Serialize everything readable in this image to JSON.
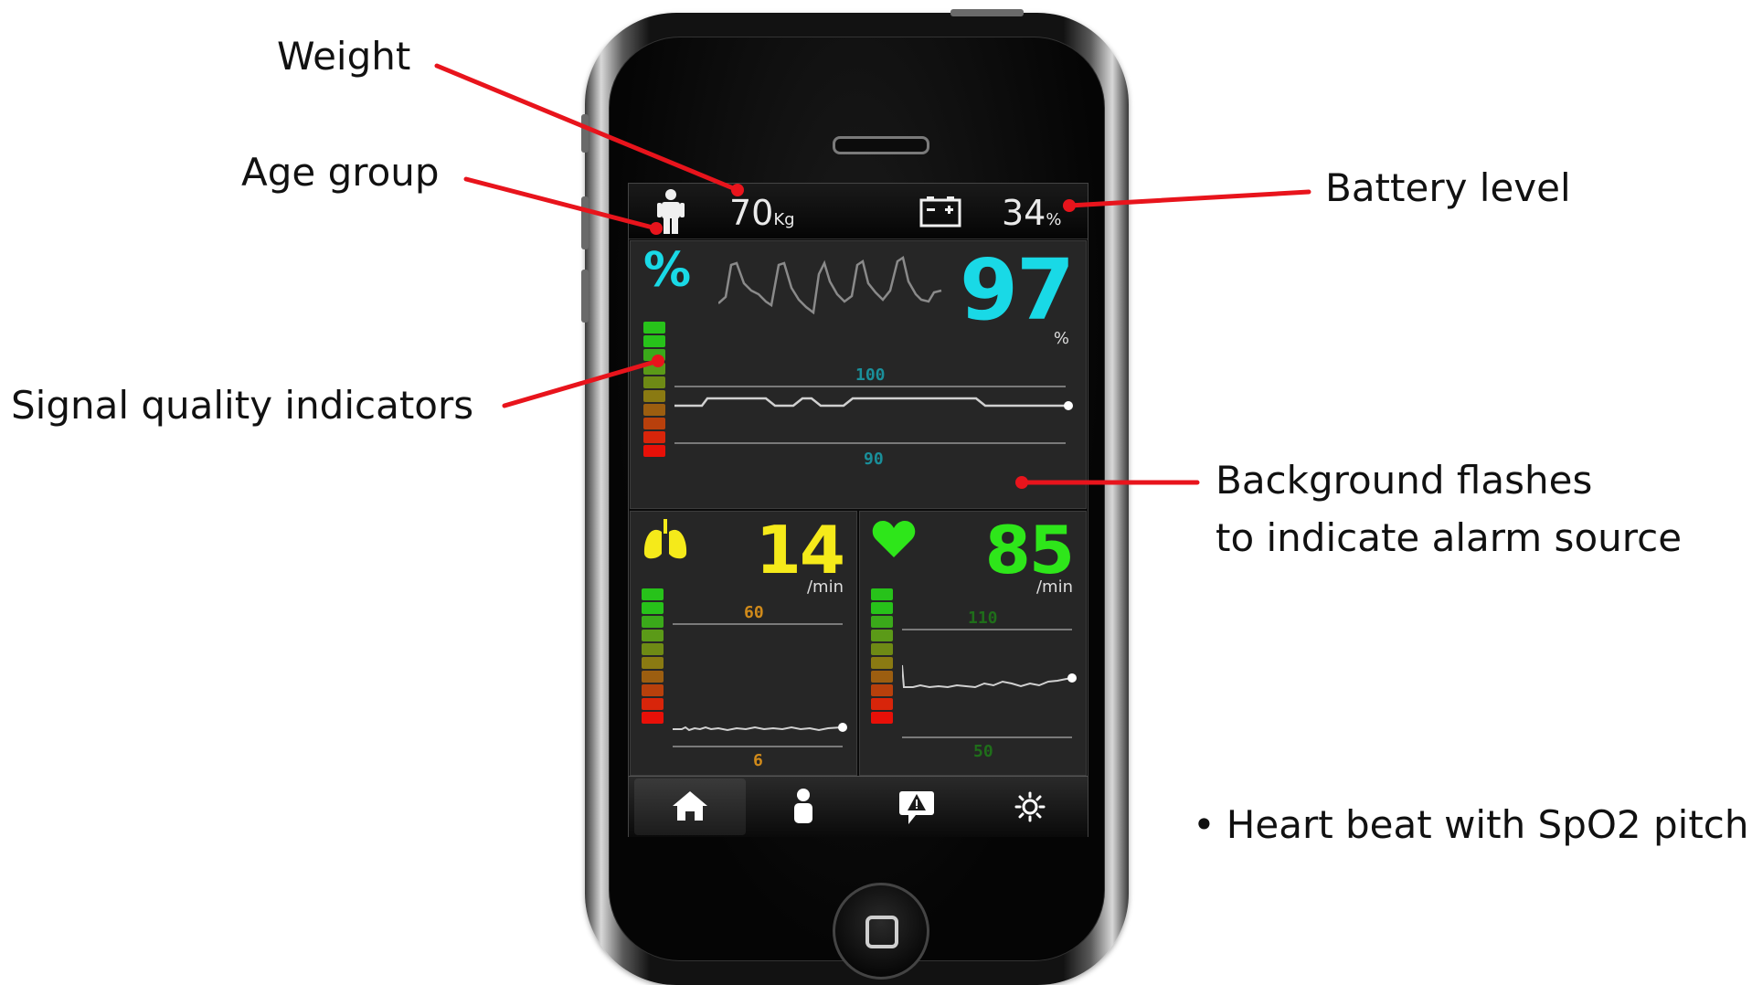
{
  "annotations": {
    "weight": "Weight",
    "age_group": "Age group",
    "battery_level": "Battery level",
    "signal_quality": "Signal quality indicators",
    "background_flash_line1": "Background flashes",
    "background_flash_line2": "to indicate alarm source",
    "heart_beat_note": "Heart beat with SpO2 pitch"
  },
  "status_bar": {
    "weight_value": "70",
    "weight_unit": "Kg",
    "battery_value": "34",
    "battery_unit": "%"
  },
  "spo2": {
    "symbol": "%",
    "value": "97",
    "unit": "%",
    "upper_limit": "100",
    "lower_limit": "90",
    "color": "#19d9e6"
  },
  "respiration": {
    "value": "14",
    "unit": "/min",
    "upper_limit": "60",
    "lower_limit": "6",
    "color": "#f5ea1a",
    "limit_color": "#d08a1a"
  },
  "heart_rate": {
    "value": "85",
    "unit": "/min",
    "upper_limit": "110",
    "lower_limit": "50",
    "color": "#2ee61a",
    "limit_color": "#1f6e1a"
  },
  "signal_quality_colors": [
    "#27c21a",
    "#27c21a",
    "#3aa91a",
    "#5b9a18",
    "#6e8a15",
    "#8a7a12",
    "#9c5e10",
    "#b8400c",
    "#d8250a",
    "#e81008"
  ],
  "tabs": [
    {
      "icon": "home-icon",
      "active": true
    },
    {
      "icon": "person-icon",
      "active": false
    },
    {
      "icon": "alarm-icon",
      "active": false
    },
    {
      "icon": "settings-icon",
      "active": false
    }
  ],
  "callout_color": "#e8141c"
}
